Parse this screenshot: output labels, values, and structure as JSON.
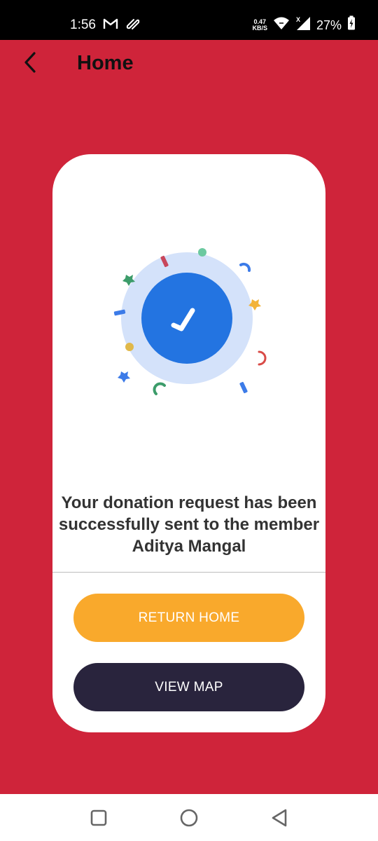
{
  "status_bar": {
    "time": "1:56",
    "left_icons": [
      "gmail-icon",
      "sync-icon"
    ],
    "net_speed_value": "0.47",
    "net_speed_unit": "KB/S",
    "battery_percent": "27%"
  },
  "app_bar": {
    "title": "Home"
  },
  "card": {
    "message": "Your donation request has been successfully sent to the member Aditya Mangal",
    "return_home_label": "RETURN HOME",
    "view_map_label": "VIEW MAP"
  },
  "colors": {
    "background": "#cf243a",
    "card": "#ffffff",
    "accent_blue": "#2374e1",
    "return_home_button": "#f9a92c",
    "view_map_button": "#29243d"
  },
  "nav_bar": {
    "icons": [
      "recent-apps-icon",
      "home-icon",
      "back-triangle-icon"
    ]
  }
}
